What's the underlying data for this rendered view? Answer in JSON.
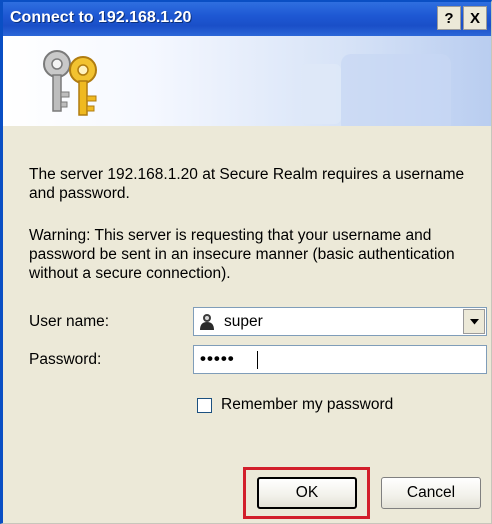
{
  "window": {
    "title": "Connect to 192.168.1.20",
    "help_button": "?",
    "close_button": "X"
  },
  "message": "The server 192.168.1.20 at Secure Realm requires a username and password.",
  "warning": "Warning: This server is requesting that your username and password be sent in an insecure manner (basic authentication without a secure connection).",
  "form": {
    "username_label": "User name:",
    "username_value": "super",
    "password_label": "Password:",
    "password_value": "•••••",
    "remember_label": "Remember my password",
    "remember_checked": false
  },
  "buttons": {
    "ok": "OK",
    "cancel": "Cancel"
  },
  "colors": {
    "titlebar": "#1e58d3",
    "highlight": "#d21f2b"
  }
}
